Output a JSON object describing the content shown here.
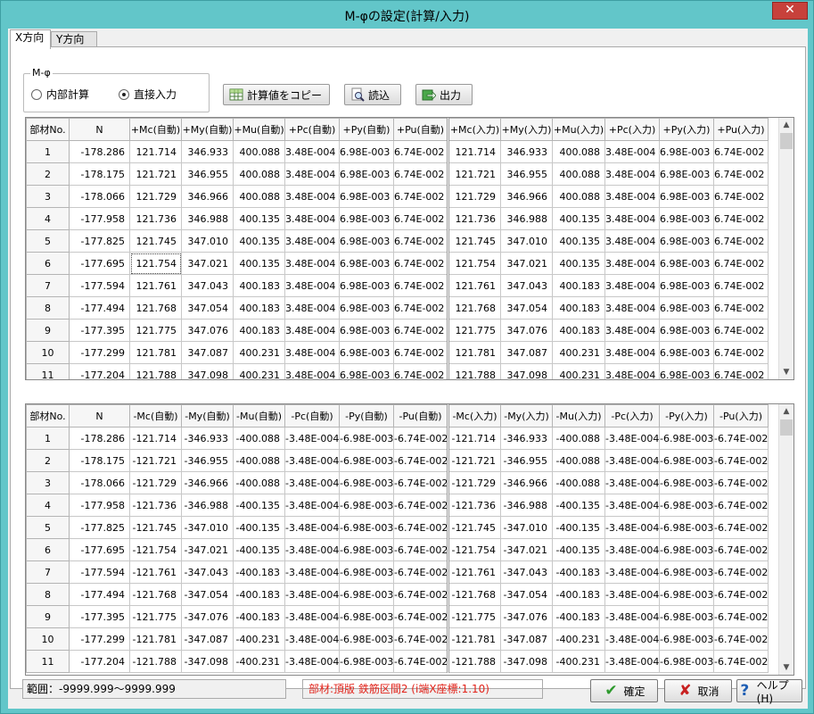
{
  "window": {
    "title": "M-φの設定(計算/入力)",
    "close_label": "✕"
  },
  "tabs": [
    {
      "label": "X方向",
      "active": true
    },
    {
      "label": "Y方向",
      "active": false
    }
  ],
  "mphi_group": {
    "label": "M-φ",
    "options": [
      {
        "label": "内部計算",
        "selected": false
      },
      {
        "label": "直接入力",
        "selected": true
      }
    ]
  },
  "toolbar": {
    "copy_label": "計算値をコピー",
    "load_label": "読込",
    "output_label": "出力"
  },
  "positive_table": {
    "headers": [
      "部材No.",
      "N",
      "+Mc(自動)",
      "+My(自動)",
      "+Mu(自動)",
      "+Pc(自動)",
      "+Py(自動)",
      "+Pu(自動)",
      "+Mc(入力)",
      "+My(入力)",
      "+Mu(入力)",
      "+Pc(入力)",
      "+Py(入力)",
      "+Pu(入力)"
    ],
    "rows": [
      [
        "1",
        "-178.286",
        "121.714",
        "346.933",
        "400.088",
        "3.48E-004",
        "6.98E-003",
        "6.74E-002",
        "121.714",
        "346.933",
        "400.088",
        "3.48E-004",
        "6.98E-003",
        "6.74E-002"
      ],
      [
        "2",
        "-178.175",
        "121.721",
        "346.955",
        "400.088",
        "3.48E-004",
        "6.98E-003",
        "6.74E-002",
        "121.721",
        "346.955",
        "400.088",
        "3.48E-004",
        "6.98E-003",
        "6.74E-002"
      ],
      [
        "3",
        "-178.066",
        "121.729",
        "346.966",
        "400.088",
        "3.48E-004",
        "6.98E-003",
        "6.74E-002",
        "121.729",
        "346.966",
        "400.088",
        "3.48E-004",
        "6.98E-003",
        "6.74E-002"
      ],
      [
        "4",
        "-177.958",
        "121.736",
        "346.988",
        "400.135",
        "3.48E-004",
        "6.98E-003",
        "6.74E-002",
        "121.736",
        "346.988",
        "400.135",
        "3.48E-004",
        "6.98E-003",
        "6.74E-002"
      ],
      [
        "5",
        "-177.825",
        "121.745",
        "347.010",
        "400.135",
        "3.48E-004",
        "6.98E-003",
        "6.74E-002",
        "121.745",
        "347.010",
        "400.135",
        "3.48E-004",
        "6.98E-003",
        "6.74E-002"
      ],
      [
        "6",
        "-177.695",
        "121.754",
        "347.021",
        "400.135",
        "3.48E-004",
        "6.98E-003",
        "6.74E-002",
        "121.754",
        "347.021",
        "400.135",
        "3.48E-004",
        "6.98E-003",
        "6.74E-002"
      ],
      [
        "7",
        "-177.594",
        "121.761",
        "347.043",
        "400.183",
        "3.48E-004",
        "6.98E-003",
        "6.74E-002",
        "121.761",
        "347.043",
        "400.183",
        "3.48E-004",
        "6.98E-003",
        "6.74E-002"
      ],
      [
        "8",
        "-177.494",
        "121.768",
        "347.054",
        "400.183",
        "3.48E-004",
        "6.98E-003",
        "6.74E-002",
        "121.768",
        "347.054",
        "400.183",
        "3.48E-004",
        "6.98E-003",
        "6.74E-002"
      ],
      [
        "9",
        "-177.395",
        "121.775",
        "347.076",
        "400.183",
        "3.48E-004",
        "6.98E-003",
        "6.74E-002",
        "121.775",
        "347.076",
        "400.183",
        "3.48E-004",
        "6.98E-003",
        "6.74E-002"
      ],
      [
        "10",
        "-177.299",
        "121.781",
        "347.087",
        "400.231",
        "3.48E-004",
        "6.98E-003",
        "6.74E-002",
        "121.781",
        "347.087",
        "400.231",
        "3.48E-004",
        "6.98E-003",
        "6.74E-002"
      ],
      [
        "11",
        "-177.204",
        "121.788",
        "347.098",
        "400.231",
        "3.48E-004",
        "6.98E-003",
        "6.74E-002",
        "121.788",
        "347.098",
        "400.231",
        "3.48E-004",
        "6.98E-003",
        "6.74E-002"
      ]
    ]
  },
  "negative_table": {
    "headers": [
      "部材No.",
      "N",
      "-Mc(自動)",
      "-My(自動)",
      "-Mu(自動)",
      "-Pc(自動)",
      "-Py(自動)",
      "-Pu(自動)",
      "-Mc(入力)",
      "-My(入力)",
      "-Mu(入力)",
      "-Pc(入力)",
      "-Py(入力)",
      "-Pu(入力)"
    ],
    "rows": [
      [
        "1",
        "-178.286",
        "-121.714",
        "-346.933",
        "-400.088",
        "-3.48E-004",
        "-6.98E-003",
        "-6.74E-002",
        "-121.714",
        "-346.933",
        "-400.088",
        "-3.48E-004",
        "-6.98E-003",
        "-6.74E-002"
      ],
      [
        "2",
        "-178.175",
        "-121.721",
        "-346.955",
        "-400.088",
        "-3.48E-004",
        "-6.98E-003",
        "-6.74E-002",
        "-121.721",
        "-346.955",
        "-400.088",
        "-3.48E-004",
        "-6.98E-003",
        "-6.74E-002"
      ],
      [
        "3",
        "-178.066",
        "-121.729",
        "-346.966",
        "-400.088",
        "-3.48E-004",
        "-6.98E-003",
        "-6.74E-002",
        "-121.729",
        "-346.966",
        "-400.088",
        "-3.48E-004",
        "-6.98E-003",
        "-6.74E-002"
      ],
      [
        "4",
        "-177.958",
        "-121.736",
        "-346.988",
        "-400.135",
        "-3.48E-004",
        "-6.98E-003",
        "-6.74E-002",
        "-121.736",
        "-346.988",
        "-400.135",
        "-3.48E-004",
        "-6.98E-003",
        "-6.74E-002"
      ],
      [
        "5",
        "-177.825",
        "-121.745",
        "-347.010",
        "-400.135",
        "-3.48E-004",
        "-6.98E-003",
        "-6.74E-002",
        "-121.745",
        "-347.010",
        "-400.135",
        "-3.48E-004",
        "-6.98E-003",
        "-6.74E-002"
      ],
      [
        "6",
        "-177.695",
        "-121.754",
        "-347.021",
        "-400.135",
        "-3.48E-004",
        "-6.98E-003",
        "-6.74E-002",
        "-121.754",
        "-347.021",
        "-400.135",
        "-3.48E-004",
        "-6.98E-003",
        "-6.74E-002"
      ],
      [
        "7",
        "-177.594",
        "-121.761",
        "-347.043",
        "-400.183",
        "-3.48E-004",
        "-6.98E-003",
        "-6.74E-002",
        "-121.761",
        "-347.043",
        "-400.183",
        "-3.48E-004",
        "-6.98E-003",
        "-6.74E-002"
      ],
      [
        "8",
        "-177.494",
        "-121.768",
        "-347.054",
        "-400.183",
        "-3.48E-004",
        "-6.98E-003",
        "-6.74E-002",
        "-121.768",
        "-347.054",
        "-400.183",
        "-3.48E-004",
        "-6.98E-003",
        "-6.74E-002"
      ],
      [
        "9",
        "-177.395",
        "-121.775",
        "-347.076",
        "-400.183",
        "-3.48E-004",
        "-6.98E-003",
        "-6.74E-002",
        "-121.775",
        "-347.076",
        "-400.183",
        "-3.48E-004",
        "-6.98E-003",
        "-6.74E-002"
      ],
      [
        "10",
        "-177.299",
        "-121.781",
        "-347.087",
        "-400.231",
        "-3.48E-004",
        "-6.98E-003",
        "-6.74E-002",
        "-121.781",
        "-347.087",
        "-400.231",
        "-3.48E-004",
        "-6.98E-003",
        "-6.74E-002"
      ],
      [
        "11",
        "-177.204",
        "-121.788",
        "-347.098",
        "-400.231",
        "-3.48E-004",
        "-6.98E-003",
        "-6.74E-002",
        "-121.788",
        "-347.098",
        "-400.231",
        "-3.48E-004",
        "-6.98E-003",
        "-6.74E-002"
      ]
    ]
  },
  "status": {
    "range_text": "範囲：-9999.999～9999.999",
    "member_text": "部材:頂版 鉄筋区間2 (i端X座標:1.10)"
  },
  "buttons": {
    "ok_label": "確定",
    "cancel_label": "取消",
    "help_label": "ヘルプ(H)"
  },
  "icons": {
    "ok": "check-icon",
    "cancel": "x-icon",
    "help": "question-icon",
    "copy": "table-copy-icon",
    "load": "magnifier-icon",
    "output": "export-icon"
  },
  "colors": {
    "titlebar": "#62c6c9",
    "close": "#c7413b",
    "status_text": "#e2231a",
    "ok_check": "#2e9a2e",
    "cancel_x": "#c82020",
    "help_q": "#1f5fb4"
  }
}
